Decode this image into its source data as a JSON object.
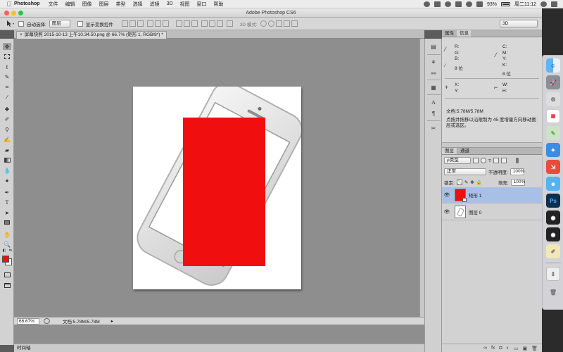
{
  "menubar": {
    "apple": "",
    "app_name": "Photoshop",
    "items": [
      "文件",
      "编辑",
      "图像",
      "图层",
      "类型",
      "选择",
      "滤镜",
      "3D",
      "视图",
      "窗口",
      "帮助"
    ],
    "battery": "93%",
    "clock": "周二11:12"
  },
  "window": {
    "title": "Adobe Photoshop CS6"
  },
  "options": {
    "auto_select_label": "自动选择:",
    "auto_select_value": "图层",
    "show_transform_label": "显示变换控件",
    "mode3d_label": "3D 模式:",
    "workspace_value": "3D"
  },
  "document": {
    "tab_title": "屏幕快照 2015-10-13 上午10.34.50.png @ 66.7% (矩形 1, RGB/8*) *",
    "zoom": "66.67%",
    "doc_info": "文档:5.78M/5.78M",
    "timeline_label": "时间轴"
  },
  "panels": {
    "info_tabs": [
      "属性",
      "信息"
    ],
    "info": {
      "rgb_labels": [
        "R:",
        "G:",
        "B:"
      ],
      "rgb_bits": "8 位",
      "cmyk_labels": [
        "C:",
        "M:",
        "Y:",
        "K:"
      ],
      "cmyk_bits": "8 位",
      "xy_labels": [
        "X:",
        "Y:"
      ],
      "wh_labels": [
        "W:",
        "H:"
      ],
      "file_size": "文档:5.78M/5.78M",
      "hint": "点按并拖移以沿限制为 45 度增量方向移动图层或选区。"
    },
    "layer_tabs": [
      "图层",
      "通道"
    ],
    "kind_filter": "ρ类型",
    "blend_mode": "正常",
    "opacity_label": "不透明度:",
    "opacity_value": "100%",
    "lock_label": "锁定:",
    "fill_label": "填充:",
    "fill_value": "100%",
    "layers": [
      {
        "name": "矩形 1",
        "selected": true
      },
      {
        "name": "图层 0",
        "selected": false
      }
    ]
  },
  "colors": {
    "foreground": "#f00e0e",
    "background": "#ffffff",
    "shape_fill": "#f00e0e",
    "selected_layer": "#a9c0e6"
  }
}
